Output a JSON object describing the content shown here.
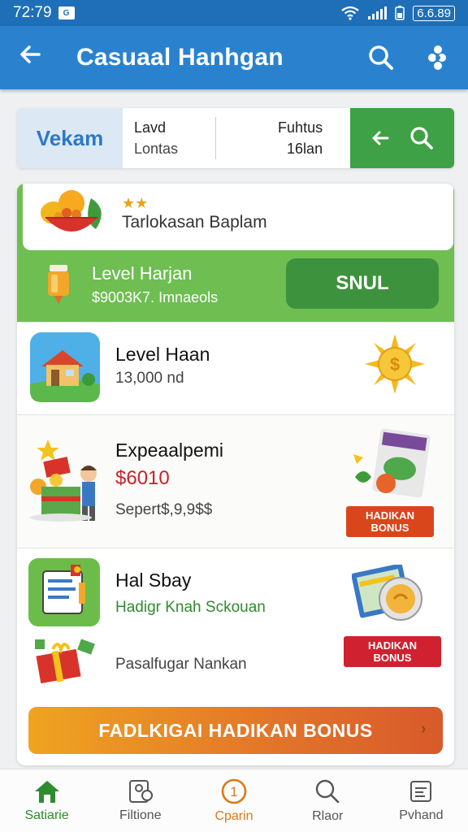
{
  "status_bar": {
    "time": "72:79",
    "notif": "G",
    "battery_text": "6.6.89"
  },
  "app_bar": {
    "title": "Casuaal Hanhgan",
    "icons": [
      "back-arrow-icon",
      "search-icon",
      "puzzle-icon"
    ]
  },
  "filter": {
    "logo_text": "Vekam",
    "col1_title": "Lavd",
    "col1_sub": "Lontas",
    "col2_title": "Fuhtus",
    "col2_sub": "16lan"
  },
  "promo": {
    "stars": "★★",
    "title": "Tarlokasan Baplam",
    "level_title": "Level Harjan",
    "level_sub": "$9003K7. Imnaeols",
    "button": "SNUL"
  },
  "items": [
    {
      "title": "Level Haan",
      "sub": "13,000 nd"
    },
    {
      "title": "Expeaalpemi",
      "price": "$6010",
      "sub": "Sepert$,9,9$$",
      "badge": "HADIKAN BONUS"
    },
    {
      "title": "Hal Sbay",
      "green": "Hadigr Knah Sckouan",
      "sub": "Pasalfugar Nankan",
      "badge": "HADIKAN BONUS"
    }
  ],
  "bonus_button": "FADLKIGAI HADIKAN BONUS",
  "bottom_nav": [
    {
      "label": "Satiarie",
      "icon": "home-icon"
    },
    {
      "label": "Filtione",
      "icon": "profile-card-icon"
    },
    {
      "label": "Cparin",
      "icon": "coin-icon"
    },
    {
      "label": "Rlaor",
      "icon": "search-icon"
    },
    {
      "label": "Pvhand",
      "icon": "document-icon"
    }
  ],
  "colors": {
    "primary": "#2a82cf",
    "accent_green": "#3fa145",
    "panel_green": "#6ebe52",
    "price_red": "#c7222b",
    "bonus_orange": "#efa420"
  }
}
